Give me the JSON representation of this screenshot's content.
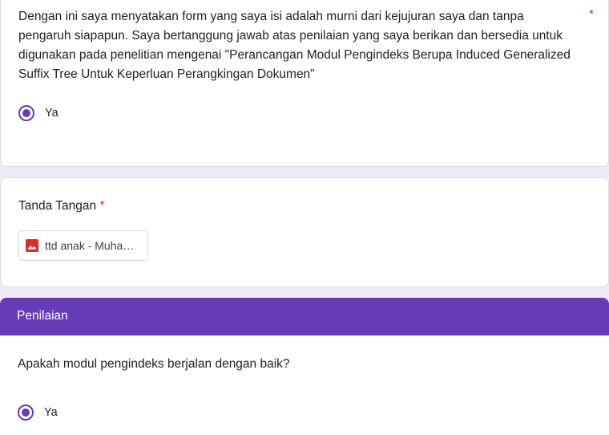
{
  "question1": {
    "text": "Dengan ini saya menyatakan form yang saya isi adalah murni dari kejujuran saya dan tanpa pengaruh siapapun. Saya bertanggung jawab atas penilaian yang saya berikan dan bersedia untuk digunakan pada penelitian mengenai \"Perancangan Modul Pengindeks Berupa Induced Generalized Suffix Tree Untuk Keperluan Perangkingan Dokumen\"",
    "required_marker": "*",
    "option_label": "Ya",
    "selected": true
  },
  "signature": {
    "title": "Tanda Tangan",
    "required_marker": "*",
    "file_name": "ttd anak - Muhammad",
    "file_icon": "image-file-icon"
  },
  "section": {
    "title": "Penilaian"
  },
  "question2": {
    "text": "Apakah modul pengindeks berjalan dengan baik?",
    "option_label": "Ya",
    "selected": true
  },
  "colors": {
    "accent": "#673ab7",
    "background": "#f0ebf8",
    "required": "#d93025",
    "image_icon": "#d93025"
  }
}
